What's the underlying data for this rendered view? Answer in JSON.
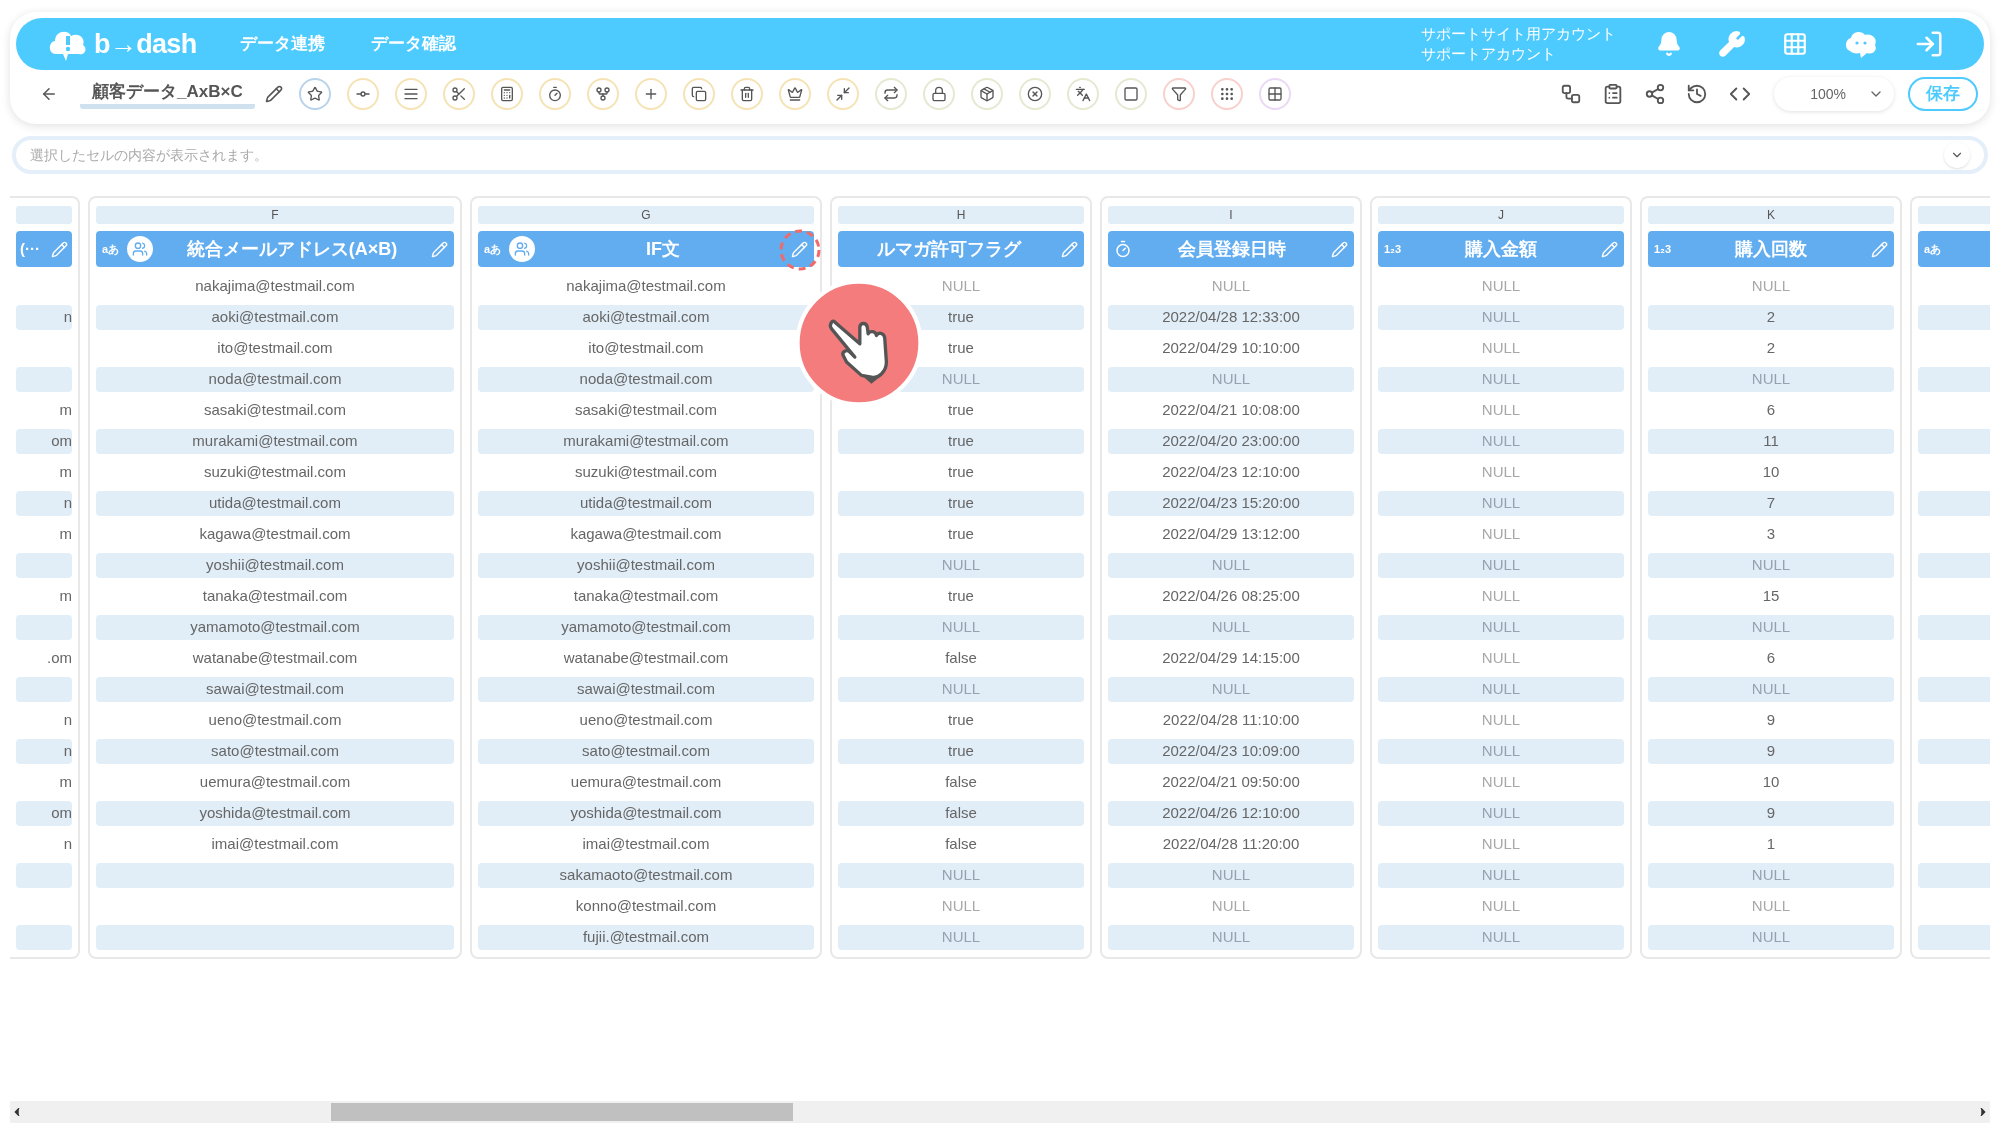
{
  "header": {
    "logo": "b→dash",
    "nav": [
      "データ連携",
      "データ確認"
    ],
    "account": [
      "サポートサイト用アカウント",
      "サポートアカウント"
    ]
  },
  "toolbar": {
    "title": "顧客データ_AxB×C",
    "zoom": "100%",
    "save": "保存"
  },
  "cell_view": {
    "placeholder": "選択したセルの内容が表示されます。"
  },
  "columns": [
    {
      "kind": "left_cut",
      "title": "(···",
      "type": {
        "kind": "none"
      },
      "linked": false,
      "cells": [
        {
          "text": ""
        },
        {
          "text": "n"
        },
        {
          "text": ""
        },
        {
          "text": ""
        },
        {
          "text": "m"
        },
        {
          "text": "om"
        },
        {
          "text": "m"
        },
        {
          "text": "n"
        },
        {
          "text": "m"
        },
        {
          "text": ""
        },
        {
          "text": "m"
        },
        {
          "text": ""
        },
        {
          "text": ".om"
        },
        {
          "text": ""
        },
        {
          "text": "n"
        },
        {
          "text": "n"
        },
        {
          "text": "m"
        },
        {
          "text": "om"
        },
        {
          "text": "n"
        },
        {
          "text": ""
        },
        {
          "text": ""
        },
        {
          "text": ""
        }
      ]
    },
    {
      "kind": "full",
      "letter": "F",
      "title": "統合メールアドレス(A×B)",
      "type": {
        "kind": "text",
        "label": "aあ"
      },
      "linked": true,
      "cells": [
        {
          "text": "nakajima@testmail.com"
        },
        {
          "text": "aoki@testmail.com"
        },
        {
          "text": "ito@testmail.com"
        },
        {
          "text": "noda@testmail.com"
        },
        {
          "text": "sasaki@testmail.com"
        },
        {
          "text": "murakami@testmail.com"
        },
        {
          "text": "suzuki@testmail.com"
        },
        {
          "text": "utida@testmail.com"
        },
        {
          "text": "kagawa@testmail.com"
        },
        {
          "text": "yoshii@testmail.com"
        },
        {
          "text": "tanaka@testmail.com"
        },
        {
          "text": "yamamoto@testmail.com"
        },
        {
          "text": "watanabe@testmail.com"
        },
        {
          "text": "sawai@testmail.com"
        },
        {
          "text": "ueno@testmail.com"
        },
        {
          "text": "sato@testmail.com"
        },
        {
          "text": "uemura@testmail.com"
        },
        {
          "text": "yoshida@testmail.com"
        },
        {
          "text": "imai@testmail.com"
        },
        {
          "text": ""
        },
        {
          "text": ""
        },
        {
          "text": ""
        }
      ]
    },
    {
      "kind": "full",
      "letter": "G",
      "title": "IF文",
      "type": {
        "kind": "text",
        "label": "aあ"
      },
      "linked": true,
      "cells": [
        {
          "text": "nakajima@testmail.com"
        },
        {
          "text": "aoki@testmail.com"
        },
        {
          "text": "ito@testmail.com"
        },
        {
          "text": "noda@testmail.com"
        },
        {
          "text": "sasaki@testmail.com"
        },
        {
          "text": "murakami@testmail.com"
        },
        {
          "text": "suzuki@testmail.com"
        },
        {
          "text": "utida@testmail.com"
        },
        {
          "text": "kagawa@testmail.com"
        },
        {
          "text": "yoshii@testmail.com"
        },
        {
          "text": "tanaka@testmail.com"
        },
        {
          "text": "yamamoto@testmail.com"
        },
        {
          "text": "watanabe@testmail.com"
        },
        {
          "text": "sawai@testmail.com"
        },
        {
          "text": "ueno@testmail.com"
        },
        {
          "text": "sato@testmail.com"
        },
        {
          "text": "uemura@testmail.com"
        },
        {
          "text": "yoshida@testmail.com"
        },
        {
          "text": "imai@testmail.com"
        },
        {
          "text": "sakamaoto@testmail.com"
        },
        {
          "text": "konno@testmail.com"
        },
        {
          "text": "fujii.@testmail.com"
        }
      ]
    },
    {
      "kind": "full",
      "letter": "H",
      "title": "ルマガ許可フラグ",
      "type": {
        "kind": "none"
      },
      "linked": false,
      "cells": [
        {
          "text": "NULL",
          "null": true
        },
        {
          "text": "true"
        },
        {
          "text": "true"
        },
        {
          "text": "NULL",
          "null": true
        },
        {
          "text": "true"
        },
        {
          "text": "true"
        },
        {
          "text": "true"
        },
        {
          "text": "true"
        },
        {
          "text": "true"
        },
        {
          "text": "NULL",
          "null": true
        },
        {
          "text": "true"
        },
        {
          "text": "NULL",
          "null": true
        },
        {
          "text": "false"
        },
        {
          "text": "NULL",
          "null": true
        },
        {
          "text": "true"
        },
        {
          "text": "true"
        },
        {
          "text": "false"
        },
        {
          "text": "false"
        },
        {
          "text": "false"
        },
        {
          "text": "NULL",
          "null": true
        },
        {
          "text": "NULL",
          "null": true
        },
        {
          "text": "NULL",
          "null": true
        }
      ]
    },
    {
      "kind": "full",
      "letter": "I",
      "title": "会員登録日時",
      "type": {
        "kind": "datetime"
      },
      "linked": false,
      "cells": [
        {
          "text": "NULL",
          "null": true
        },
        {
          "text": "2022/04/28 12:33:00"
        },
        {
          "text": "2022/04/29 10:10:00"
        },
        {
          "text": "NULL",
          "null": true
        },
        {
          "text": "2022/04/21 10:08:00"
        },
        {
          "text": "2022/04/20 23:00:00"
        },
        {
          "text": "2022/04/23 12:10:00"
        },
        {
          "text": "2022/04/23 15:20:00"
        },
        {
          "text": "2022/04/29 13:12:00"
        },
        {
          "text": "NULL",
          "null": true
        },
        {
          "text": "2022/04/26 08:25:00"
        },
        {
          "text": "NULL",
          "null": true
        },
        {
          "text": "2022/04/29 14:15:00"
        },
        {
          "text": "NULL",
          "null": true
        },
        {
          "text": "2022/04/28 11:10:00"
        },
        {
          "text": "2022/04/23 10:09:00"
        },
        {
          "text": "2022/04/21 09:50:00"
        },
        {
          "text": "2022/04/26 12:10:00"
        },
        {
          "text": "2022/04/28 11:20:00"
        },
        {
          "text": "NULL",
          "null": true
        },
        {
          "text": "NULL",
          "null": true
        },
        {
          "text": "NULL",
          "null": true
        }
      ]
    },
    {
      "kind": "full",
      "letter": "J",
      "title": "購入金額",
      "type": {
        "kind": "number",
        "label": "1₂3"
      },
      "linked": false,
      "cells": [
        {
          "text": "NULL",
          "null": true
        },
        {
          "text": "NULL",
          "null": true
        },
        {
          "text": "NULL",
          "null": true
        },
        {
          "text": "NULL",
          "null": true
        },
        {
          "text": "NULL",
          "null": true
        },
        {
          "text": "NULL",
          "null": true
        },
        {
          "text": "NULL",
          "null": true
        },
        {
          "text": "NULL",
          "null": true
        },
        {
          "text": "NULL",
          "null": true
        },
        {
          "text": "NULL",
          "null": true
        },
        {
          "text": "NULL",
          "null": true
        },
        {
          "text": "NULL",
          "null": true
        },
        {
          "text": "NULL",
          "null": true
        },
        {
          "text": "NULL",
          "null": true
        },
        {
          "text": "NULL",
          "null": true
        },
        {
          "text": "NULL",
          "null": true
        },
        {
          "text": "NULL",
          "null": true
        },
        {
          "text": "NULL",
          "null": true
        },
        {
          "text": "NULL",
          "null": true
        },
        {
          "text": "NULL",
          "null": true
        },
        {
          "text": "NULL",
          "null": true
        },
        {
          "text": "NULL",
          "null": true
        }
      ]
    },
    {
      "kind": "full",
      "letter": "K",
      "title": "購入回数",
      "type": {
        "kind": "number",
        "label": "1₂3"
      },
      "linked": false,
      "cells": [
        {
          "text": "NULL",
          "null": true
        },
        {
          "text": "2"
        },
        {
          "text": "2"
        },
        {
          "text": "NULL",
          "null": true
        },
        {
          "text": "6"
        },
        {
          "text": "11"
        },
        {
          "text": "10"
        },
        {
          "text": "7"
        },
        {
          "text": "3"
        },
        {
          "text": "NULL",
          "null": true
        },
        {
          "text": "15"
        },
        {
          "text": "NULL",
          "null": true
        },
        {
          "text": "6"
        },
        {
          "text": "NULL",
          "null": true
        },
        {
          "text": "9"
        },
        {
          "text": "9"
        },
        {
          "text": "10"
        },
        {
          "text": "9"
        },
        {
          "text": "1"
        },
        {
          "text": "NULL",
          "null": true
        },
        {
          "text": "NULL",
          "null": true
        },
        {
          "text": "NULL",
          "null": true
        }
      ]
    },
    {
      "kind": "right_cut",
      "type": {
        "kind": "text",
        "label": "aあ"
      },
      "linked": false,
      "cells": [
        {
          "text": ""
        },
        {
          "text": ""
        },
        {
          "text": ""
        },
        {
          "text": ""
        },
        {
          "text": ""
        },
        {
          "text": ""
        },
        {
          "text": ""
        },
        {
          "text": ""
        },
        {
          "text": ""
        },
        {
          "text": ""
        },
        {
          "text": ""
        },
        {
          "text": ""
        },
        {
          "text": ""
        },
        {
          "text": ""
        },
        {
          "text": ""
        },
        {
          "text": ""
        },
        {
          "text": ""
        },
        {
          "text": ""
        },
        {
          "text": ""
        },
        {
          "text": ""
        },
        {
          "text": ""
        },
        {
          "text": ""
        }
      ]
    }
  ]
}
